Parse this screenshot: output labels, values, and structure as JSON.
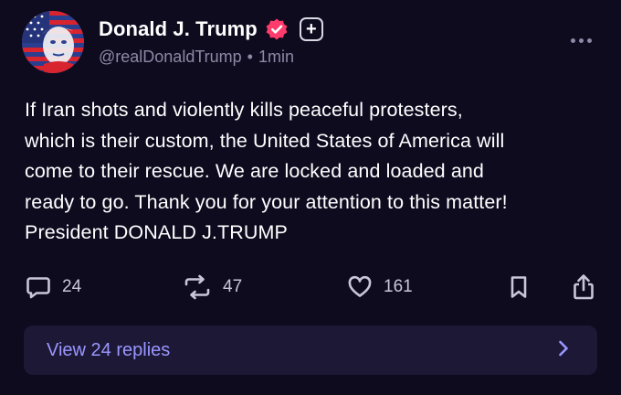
{
  "author": {
    "display_name": "Donald J. Trump",
    "handle": "@realDonaldTrump",
    "separator": "•",
    "timestamp": "1min",
    "verified_color": "#ff3b6b",
    "follow_glyph": "+"
  },
  "post": {
    "text": "If Iran shots and violently kills peaceful protesters,\nwhich is their custom, the United States of America will\ncome to their rescue. We are locked and loaded and\nready to go. Thank you for your attention to this matter!\nPresident DONALD J.TRUMP"
  },
  "actions": {
    "replies": "24",
    "reposts": "47",
    "likes": "161",
    "icons": [
      "comment-icon",
      "repost-icon",
      "heart-icon",
      "bookmark-icon",
      "share-icon"
    ]
  },
  "replies_bar": {
    "label": "View 24 replies",
    "accent": "#9b97ff"
  },
  "colors": {
    "background": "#0e0b1f",
    "muted_text": "#8d89a6",
    "panel": "#1c1836"
  }
}
